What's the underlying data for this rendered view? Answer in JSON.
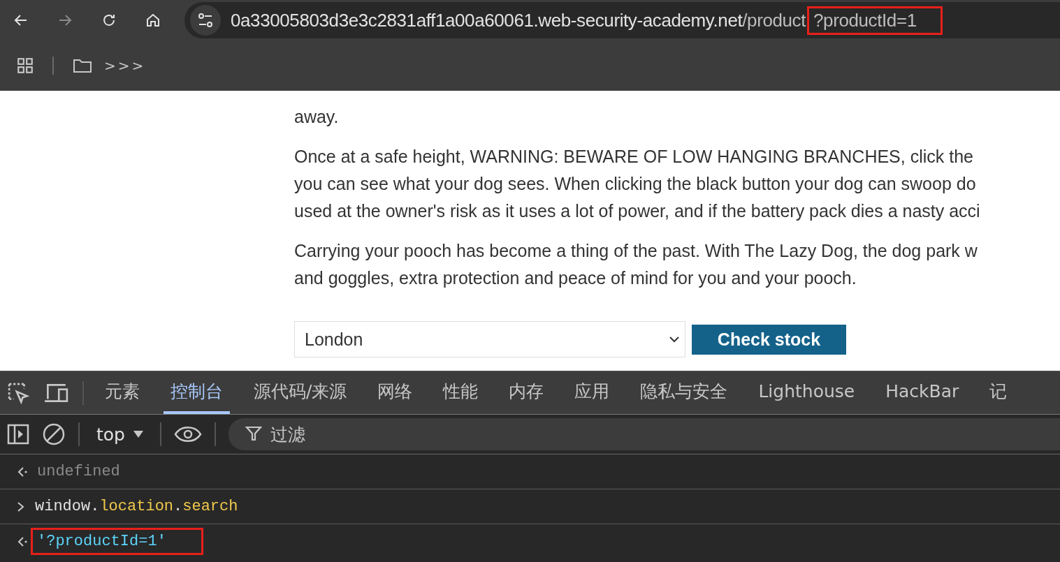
{
  "browser": {
    "url": {
      "domain": "0a33005803d3e3c2831aff1a00a60061.web-security-academy.net",
      "path": "/product",
      "query": "?productId=1",
      "query_highlighted": true
    },
    "bookmarks": {
      "overflow": ">>>"
    }
  },
  "page": {
    "paragraphs": [
      [
        "away."
      ],
      [
        "Once at a safe height, WARNING: BEWARE OF LOW HANGING BRANCHES, click the",
        "you can see what your dog sees. When clicking the black button your dog can swoop do",
        "used at the owner's risk as it uses a lot of power, and if the battery pack dies a nasty acci"
      ],
      [
        "Carrying your pooch has become a thing of the past. With The Lazy Dog, the dog park w",
        "and goggles, extra protection and peace of mind for you and your pooch."
      ]
    ],
    "store_select": {
      "value": "London"
    },
    "check_button": "Check stock"
  },
  "devtools": {
    "tabs": [
      {
        "label": "元素",
        "selected": false
      },
      {
        "label": "控制台",
        "selected": true
      },
      {
        "label": "源代码/来源",
        "selected": false
      },
      {
        "label": "网络",
        "selected": false
      },
      {
        "label": "性能",
        "selected": false
      },
      {
        "label": "内存",
        "selected": false
      },
      {
        "label": "应用",
        "selected": false
      },
      {
        "label": "隐私与安全",
        "selected": false
      },
      {
        "label": "Lighthouse",
        "selected": false
      },
      {
        "label": "HackBar",
        "selected": false
      },
      {
        "label": "记",
        "selected": false
      }
    ],
    "context": "top",
    "filter_placeholder": "过滤",
    "console": [
      {
        "kind": "result",
        "text": "undefined",
        "highlighted": false
      },
      {
        "kind": "input",
        "parts": [
          {
            "text": "window.",
            "color": "#e3e3e3"
          },
          {
            "text": "location",
            "color": "#f2c94c"
          },
          {
            "text": ".",
            "color": "#e3e3e3"
          },
          {
            "text": "search",
            "color": "#f2c94c"
          }
        ]
      },
      {
        "kind": "string",
        "text": "'?productId=1'",
        "highlighted": true
      }
    ]
  }
}
